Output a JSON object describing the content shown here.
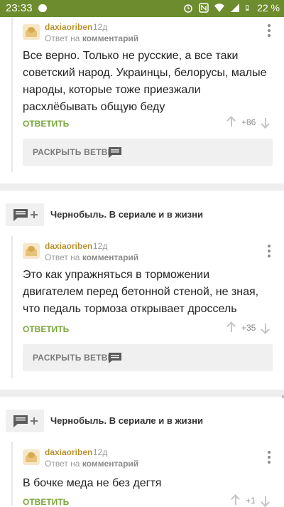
{
  "status_bar": {
    "time": "23:33",
    "battery": "22 %",
    "icons": [
      "message-icon",
      "alarm-icon",
      "nfc-icon",
      "wifi-icon",
      "signal-icon",
      "battery-icon"
    ]
  },
  "comments": [
    {
      "author": "daxiaoriben",
      "time": "12д",
      "reply_prefix": "Ответ на",
      "reply_target": "комментарий",
      "text": "Все верно. Только не русские, а все таки советский народ. Украинцы, белорусы, малые народы, которые тоже приезжали расхлёбывать общую беду",
      "reply_label": "ОТВЕТИТЬ",
      "rating": "+86",
      "expand_label": "РАСКРЫТЬ ВЕТВЬ"
    },
    {
      "post_title": "Чернобыль. В сериале и в жизни",
      "author": "daxiaoriben",
      "time": "12д",
      "reply_prefix": "Ответ на",
      "reply_target": "комментарий",
      "text": "Это как упражняться в торможении двигателем перед бетонной стеной, не зная, что педаль тормоза открывает дроссель",
      "reply_label": "ОТВЕТИТЬ",
      "rating": "+35",
      "expand_label": "РАСКРЫТЬ ВЕТВЬ"
    },
    {
      "post_title": "Чернобыль. В сериале и в жизни",
      "author": "daxiaoriben",
      "time": "12д",
      "reply_prefix": "Ответ на",
      "reply_target": "комментарий",
      "text": "В бочке меда не без дегтя",
      "reply_label": "ОТВЕТИТЬ",
      "rating": "+1"
    }
  ],
  "colors": {
    "status_bar": "#6d8c2e",
    "author": "#b8922f",
    "reply": "#7aa83a",
    "divider": "#eeeeee"
  }
}
